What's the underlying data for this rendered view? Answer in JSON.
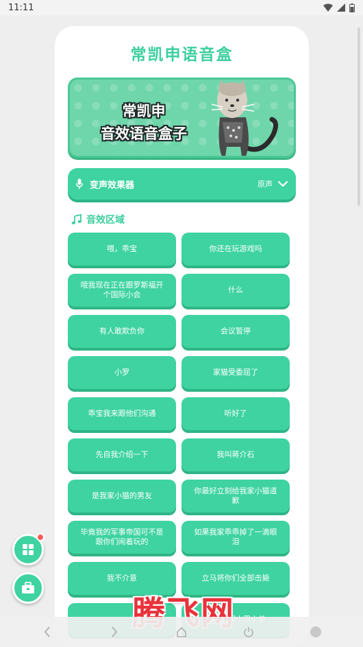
{
  "status_bar": {
    "time": "11:11",
    "icons": [
      "wifi-icon",
      "signal-icon",
      "battery-icon"
    ]
  },
  "app": {
    "title": "常凯申语音盒"
  },
  "banner": {
    "line1": "常凯申",
    "line2": "音效语音盒子"
  },
  "effect_bar": {
    "icon": "microphone-icon",
    "label": "变声效果器",
    "value": "原声",
    "dropdown_icon": "chevron-down-icon"
  },
  "section": {
    "icon": "music-note-icon",
    "title": "音效区域"
  },
  "sounds": [
    "喂，乖宝",
    "你还在玩游戏吗",
    "哦我现在正在跟罗斯福开个国际小会",
    "什么",
    "有人敢欺负你",
    "会议暂停",
    "小罗",
    "家猫受委屈了",
    "乖宝我来跟他们沟通",
    "听好了",
    "先自我介绍一下",
    "我叫蒋介石",
    "是我家小猫的男友",
    "你最好立刻给我家小猫道歉",
    "毕竟我的军事帝国可不是跟你们闹着玩的",
    "如果我家乖乖掉了一滴眼泪",
    "我不介意",
    "立马将你们全部击毙",
    "",
    "我这就跟小罗小单"
  ],
  "fabs": {
    "grid_icon": "grid-icon",
    "tool_icon": "toolbox-icon"
  },
  "nav": {
    "back": "back-icon",
    "forward": "forward-icon",
    "home": "home-icon",
    "power": "power-icon",
    "circle": "circle-icon"
  },
  "watermark": "腾飞网",
  "colors": {
    "accent": "#3ed3a0",
    "accent_dark": "#2fb585",
    "title": "#3ccf9e",
    "badge": "#ff5a5a",
    "watermark": "#e8333c"
  }
}
